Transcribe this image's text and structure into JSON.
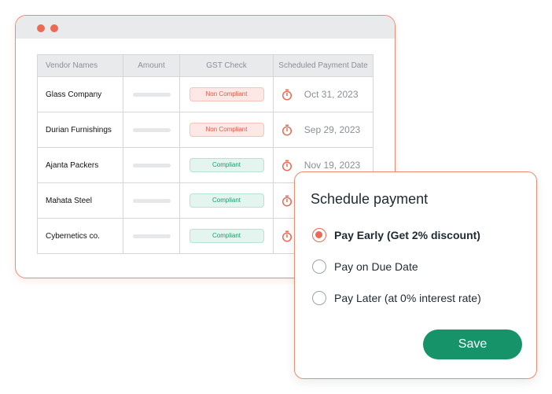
{
  "table": {
    "headers": [
      "Vendor Names",
      "Amount",
      "GST Check",
      "Scheduled Payment Date"
    ],
    "rows": [
      {
        "vendor": "Glass Company",
        "gst": "Non Compliant",
        "date": "Oct 31, 2023"
      },
      {
        "vendor": "Durian Furnishings",
        "gst": "Non Compliant",
        "date": "Sep 29, 2023"
      },
      {
        "vendor": "Ajanta Packers",
        "gst": "Compliant",
        "date": "Nov 19, 2023"
      },
      {
        "vendor": "Mahata Steel",
        "gst": "Compliant",
        "date": ""
      },
      {
        "vendor": "Cybernetics co.",
        "gst": "Compliant",
        "date": ""
      }
    ]
  },
  "modal": {
    "title": "Schedule payment",
    "options": [
      {
        "label": "Pay Early (Get 2% discount)",
        "selected": true
      },
      {
        "label": "Pay on Due Date",
        "selected": false
      },
      {
        "label": "Pay Later (at 0% interest rate)",
        "selected": false
      }
    ],
    "save_label": "Save"
  },
  "colors": {
    "accent": "#ea6a55",
    "primary_button": "#17936a",
    "non_compliant": "#e35a48",
    "compliant": "#1f9b6e"
  },
  "icons": {
    "window_dot": "window-dot-icon",
    "date": "stopwatch-icon"
  }
}
